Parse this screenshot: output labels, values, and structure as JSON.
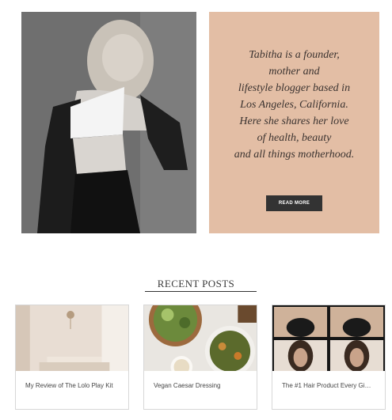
{
  "hero": {
    "photo_alt": "black-and-white portrait of a woman in a white crop top"
  },
  "bio": {
    "text": "Tabitha is a founder,\nmother and\nlifestyle blogger based in\nLos Angeles, California.\nHere she shares her love\nof health, beauty\nand all things motherhood.",
    "read_more_label": "READ MORE",
    "panel_color": "#e3bea5"
  },
  "recent_posts": {
    "heading": "RECENT POSTS",
    "posts": [
      {
        "title": "My Review of The Lolo Play Kit",
        "thumb_icon": "nursery-room-image"
      },
      {
        "title": "Vegan Caesar Dressing",
        "thumb_icon": "salad-bowl-image"
      },
      {
        "title": "The #1 Hair Product Every Gi…",
        "thumb_icon": "hair-collage-image"
      }
    ]
  }
}
